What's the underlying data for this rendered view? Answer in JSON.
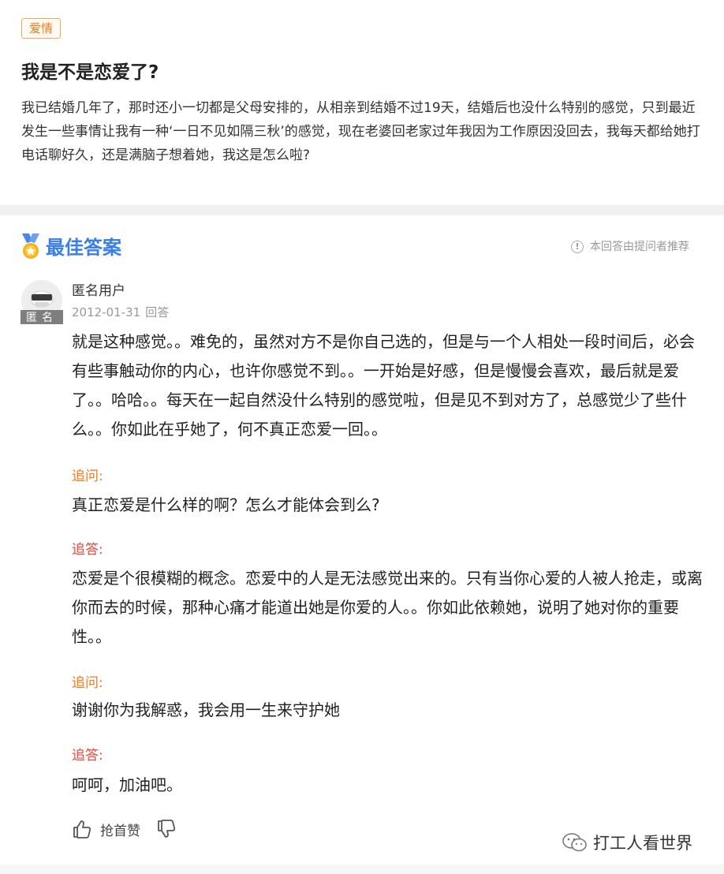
{
  "question": {
    "tag": "爱情",
    "title": "我是不是恋爱了?",
    "body": "我已结婚几年了，那时还小一切都是父母安排的，从相亲到结婚不过19天，结婚后也没什么特别的感觉，只到最近发生一些事情让我有一种‘一日不见如隔三秋’的感觉，现在老婆回老家过年我因为工作原因没回去，我每天都给她打电话聊好久，还是满脑子想着她，我这是怎么啦?"
  },
  "best_answer": {
    "title": "最佳答案",
    "recommend_note": "本回答由提问者推荐",
    "avatar_label": "匿名",
    "user": "匿名用户",
    "date": "2012-01-31",
    "action": "回答",
    "content": "就是这种感觉。。难免的，虽然对方不是你自己选的，但是与一个人相处一段时间后，必会有些事触动你的内心，也许你感觉不到。。一开始是好感，但是慢慢会喜欢，最后就是爱了。。哈哈。。每天在一起自然没什么特别的感觉啦，但是见不到对方了，总感觉少了些什么。。你如此在乎她了，何不真正恋爱一回。。",
    "followups": [
      {
        "label": "追问:",
        "text": "真正恋爱是什么样的啊？怎么才能体会到么?"
      },
      {
        "label": "追答:",
        "text": "恋爱是个很模糊的概念。恋爱中的人是无法感觉出来的。只有当你心爱的人被人抢走，或离你而去的时候，那种心痛才能道出她是你爱的人。。你如此依赖她，说明了她对你的重要性。。"
      },
      {
        "label": "追问:",
        "text": "谢谢你为我解惑，我会用一生来守护她"
      },
      {
        "label": "追答:",
        "text": "呵呵，加油吧。"
      }
    ]
  },
  "actions": {
    "like_label": "抢首赞"
  },
  "watermark": "打工人看世界",
  "colors": {
    "accent_blue": "#3a7ee8",
    "ask_orange": "#f07a1a",
    "reply_red": "#e8483c"
  }
}
